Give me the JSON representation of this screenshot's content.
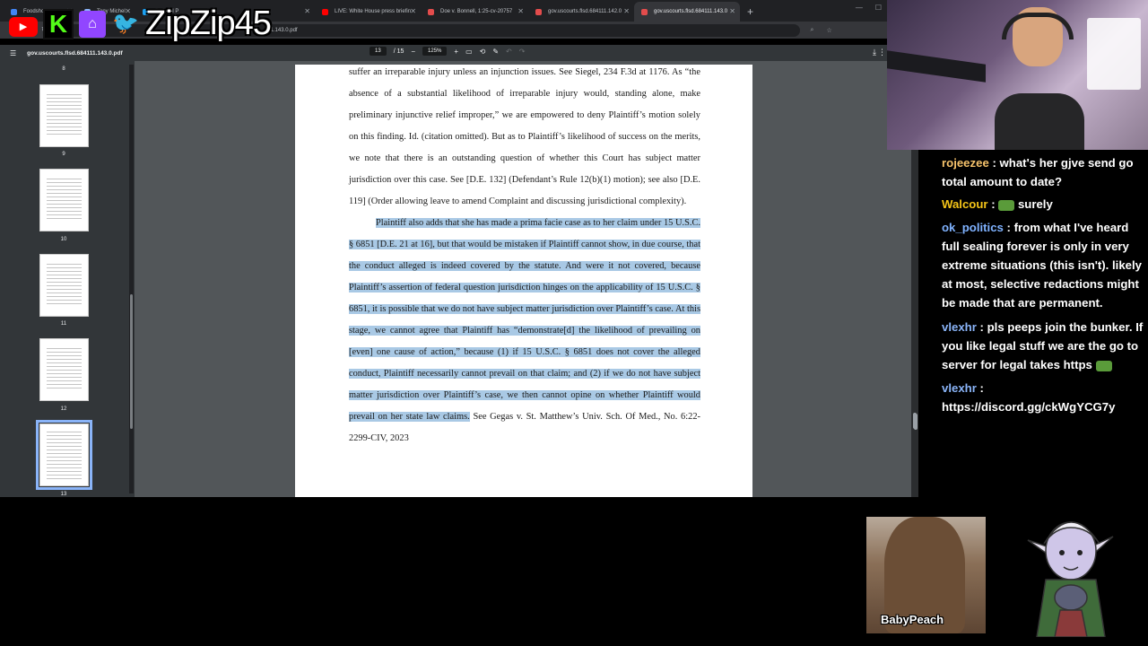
{
  "overlay": {
    "handle": "ZipZip45",
    "logos": [
      "youtube-logo",
      "kick-logo",
      "twitch-logo",
      "twitter-logo"
    ]
  },
  "browser": {
    "tabs": [
      {
        "label": "Foodshops",
        "active": false,
        "fav_color": "#4285f4"
      },
      {
        "label": "Tony Michel",
        "active": false,
        "fav_color": "#8ab4f8"
      },
      {
        "label": "Political P",
        "active": false,
        "fav_color": "#1da1f2"
      },
      {
        "label": "LIVE: White House press briefin",
        "active": false,
        "fav_color": "#ff0000"
      },
      {
        "label": "Doe v. Bonnell, 1:25-cv-20757",
        "active": false,
        "fav_color": "#e34c4c"
      },
      {
        "label": "gov.uscourts.flsd.684111.142.0",
        "active": false,
        "fav_color": "#e34c4c"
      },
      {
        "label": "gov.uscourts.flsd.684111.143.0",
        "active": true,
        "fav_color": "#e34c4c"
      }
    ],
    "new_tab": "+",
    "url": "1.143.0.pdf"
  },
  "pdf_toolbar": {
    "doc_title": "gov.uscourts.flsd.684111.143.0.pdf",
    "page_current": "13",
    "page_total": "/ 15",
    "zoom": "125%",
    "zoom_out": "−",
    "zoom_in": "+"
  },
  "thumbnails": [
    {
      "num": "8"
    },
    {
      "num": "9"
    },
    {
      "num": "10"
    },
    {
      "num": "11"
    },
    {
      "num": "12"
    },
    {
      "num": "13",
      "selected": true
    }
  ],
  "document": {
    "para1": "suffer an irreparable injury unless an injunction issues.  See Siegel, 234 F.3d at 1176. As “the absence of a substantial likelihood of irreparable injury would, standing alone, make preliminary injunctive relief improper,” we are empowered to deny Plaintiff’s motion solely on this finding.  Id. (citation omitted).  But as to Plaintiff’s likelihood of success on the merits, we note that there is an outstanding question of whether this Court has subject matter jurisdiction over this case.  See [D.E. 132] (Defendant’s Rule 12(b)(1) motion); see also [D.E. 119] (Order allowing leave to amend Complaint and discussing jurisdictional complexity).",
    "para2_highlighted": "Plaintiff also adds that she has made a prima facie case as to her claim under 15 U.S.C. § 6851 [D.E. 21 at 16], but that would be mistaken if Plaintiff cannot show, in due course, that the conduct alleged is indeed covered by the statute.  And were it not covered, because Plaintiff’s assertion of federal question jurisdiction hinges on the applicability of 15 U.S.C. § 6851, it is possible that we do not have subject matter jurisdiction over Plaintiff’s case.  At this stage, we cannot agree that Plaintiff has “demonstrate[d] the likelihood of prevailing on [even] one cause of action,” because (1) if 15 U.S.C. § 6851 does not cover the alleged conduct, Plaintiff necessarily cannot prevail on that claim; and (2) if we do not have subject matter jurisdiction over Plaintiff’s case, we then cannot opine on whether Plaintiff would prevail on her state law claims.",
    "para2_tail": " See Gegas v. St. Matthew’s Univ. Sch. Of Med., No. 6:22-2299-CIV, 2023"
  },
  "chat": [
    {
      "user": "rojeezee",
      "color": "#f5c26b",
      "text": "what's her gjve send go total amount to date?"
    },
    {
      "user": "Walcour",
      "color": "#f5c518",
      "text": "surely",
      "emote": true
    },
    {
      "user": "ok_politics",
      "color": "#7fb2ff",
      "text": "from what I've heard full sealing forever is only in very extreme situations (this isn't). likely at most, selective redactions might be made that are permanent."
    },
    {
      "user": "vlexhr",
      "color": "#8ab4f8",
      "text": "pls peeps join the bunker. If you like legal stuff we are the go to server for legal takes https",
      "emote": true
    },
    {
      "user": "vlexhr",
      "color": "#8ab4f8",
      "text": "https://discord.gg/ckWgYCG7y"
    }
  ],
  "cams": {
    "guest_label": "BabyPeach"
  }
}
